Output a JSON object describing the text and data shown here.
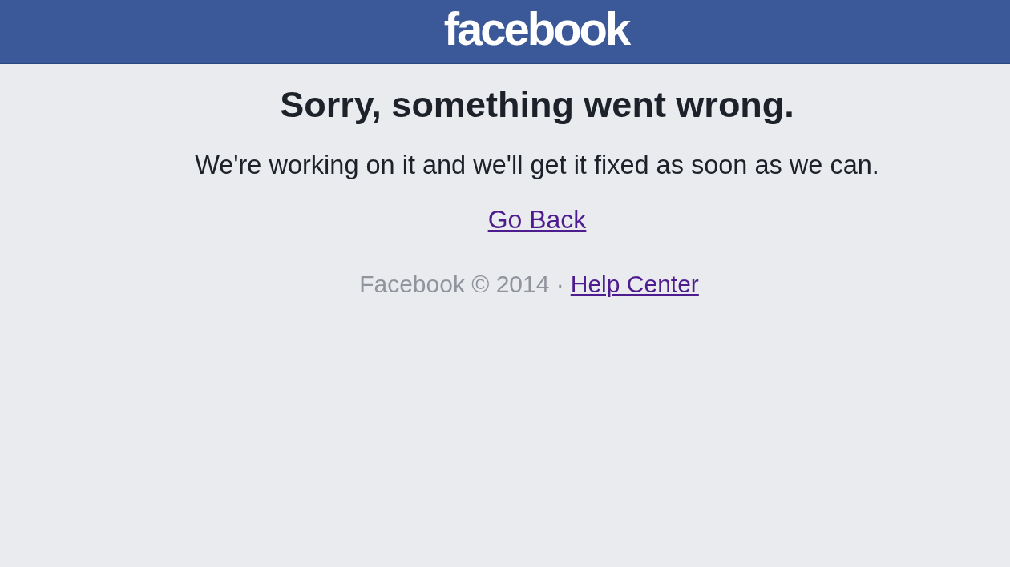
{
  "header": {
    "logo": "facebook"
  },
  "error": {
    "title": "Sorry, something went wrong.",
    "message": "We're working on it and we'll get it fixed as soon as we can.",
    "link": "Go Back"
  },
  "footer": {
    "copyright": "Facebook © 2014 ·",
    "link": "Help Center"
  }
}
